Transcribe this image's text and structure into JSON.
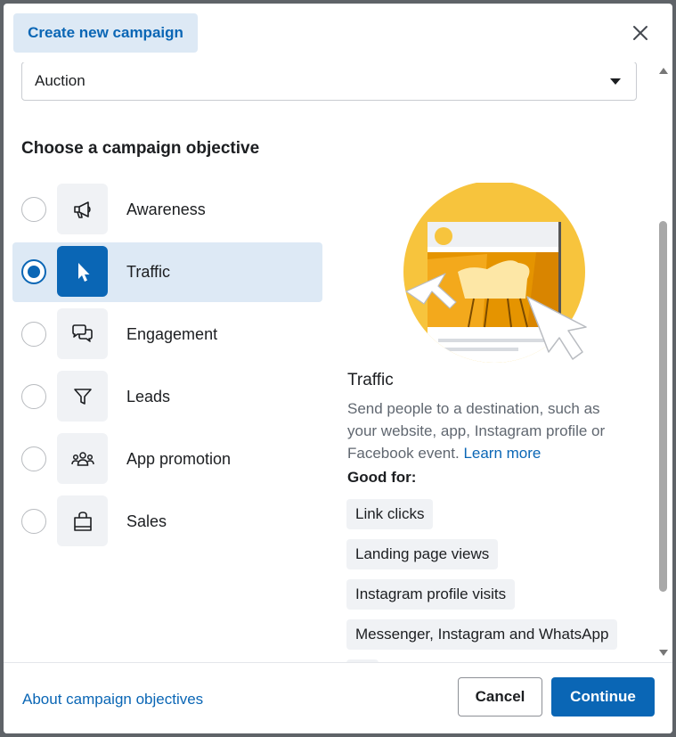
{
  "header": {
    "title": "Create new campaign",
    "close_icon": "close-icon"
  },
  "buying_type": {
    "value": "Auction"
  },
  "objective_section": {
    "title": "Choose a campaign objective",
    "options": [
      {
        "label": "Awareness",
        "icon": "megaphone-icon",
        "selected": false
      },
      {
        "label": "Traffic",
        "icon": "cursor-icon",
        "selected": true
      },
      {
        "label": "Engagement",
        "icon": "chat-bubbles-icon",
        "selected": false
      },
      {
        "label": "Leads",
        "icon": "filter-icon",
        "selected": false
      },
      {
        "label": "App promotion",
        "icon": "people-icon",
        "selected": false
      },
      {
        "label": "Sales",
        "icon": "shopping-bag-icon",
        "selected": false
      }
    ]
  },
  "detail": {
    "title": "Traffic",
    "description": "Send people to a destination, such as your website, app, Instagram profile or Facebook event.",
    "learn_more": "Learn more",
    "good_for_label": "Good for:",
    "good_for": [
      "Link clicks",
      "Landing page views",
      "Instagram profile visits",
      "Messenger, Instagram and WhatsApp"
    ]
  },
  "footer": {
    "about_link": "About campaign objectives",
    "cancel": "Cancel",
    "continue": "Continue"
  },
  "colors": {
    "accent": "#0a66b5",
    "selected_bg": "#dde9f5",
    "chip_bg": "#f0f2f5",
    "illustration_yellow": "#f7c43d",
    "illustration_orange": "#e59400"
  }
}
